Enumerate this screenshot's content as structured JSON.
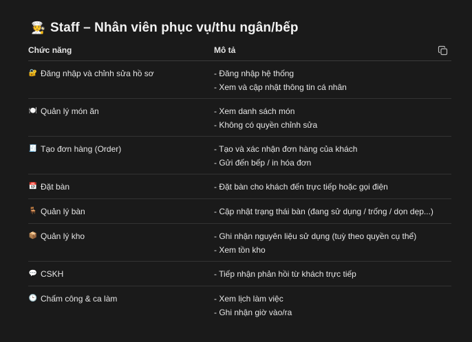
{
  "title": {
    "icon": "cook-emoji",
    "icon_glyph": "🧑‍🍳",
    "text": "Staff – Nhân viên phục vụ/thu ngân/bếp"
  },
  "table": {
    "headers": {
      "function": "Chức năng",
      "description": "Mô tả"
    },
    "copy_icon": "copy-icon",
    "rows": [
      {
        "icon": "lock-icon",
        "icon_glyph": "🔐",
        "function": "Đăng nhập và chỉnh sửa hồ sơ",
        "desc": [
          "- Đăng nhập hệ thống",
          "- Xem và cập nhật thông tin cá nhân"
        ]
      },
      {
        "icon": "plate-icon",
        "icon_glyph": "🍽️",
        "function": "Quản lý món ăn",
        "desc": [
          "- Xem danh sách món",
          "- Không có quyền chỉnh sửa"
        ]
      },
      {
        "icon": "receipt-icon",
        "icon_glyph": "🧾",
        "function": "Tạo đơn hàng (Order)",
        "desc": [
          "- Tạo và xác nhận đơn hàng của khách",
          "- Gửi đến bếp / in hóa đơn"
        ]
      },
      {
        "icon": "calendar-icon",
        "icon_glyph": "📅",
        "function": "Đặt bàn",
        "desc": [
          "- Đặt bàn cho khách đến trực tiếp hoặc gọi điện"
        ]
      },
      {
        "icon": "chair-icon",
        "icon_glyph": "🪑",
        "function": "Quản lý bàn",
        "desc": [
          "- Cập nhật trạng thái bàn (đang sử dụng / trống / dọn dẹp...)"
        ]
      },
      {
        "icon": "package-icon",
        "icon_glyph": "📦",
        "function": "Quản lý kho",
        "desc": [
          "- Ghi nhận nguyên liệu sử dụng (tuỳ theo quyền cụ thể)",
          "- Xem tồn kho"
        ]
      },
      {
        "icon": "speech-bubble-icon",
        "icon_glyph": "💬",
        "function": "CSKH",
        "desc": [
          "- Tiếp nhận phản hồi từ khách trực tiếp"
        ]
      },
      {
        "icon": "clock-icon",
        "icon_glyph": "🕒",
        "function": "Chấm công & ca làm",
        "desc": [
          "- Xem lịch làm việc",
          "- Ghi nhận giờ vào/ra"
        ]
      }
    ]
  }
}
